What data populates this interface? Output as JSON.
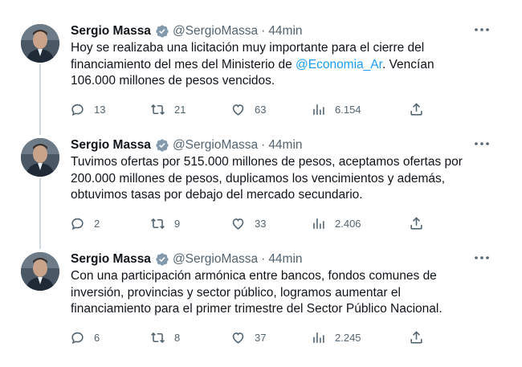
{
  "tweets": [
    {
      "author": {
        "name": "Sergio Massa",
        "handle": "@SergioMassa",
        "separator": "·",
        "time": "44min"
      },
      "text": {
        "line1": "Hoy se realizaba una licitación muy importante para el cierre del",
        "line2_before": "financiamiento del mes del Ministerio de ",
        "mention": "@Economia_Ar",
        "line2_after": ". Vencían",
        "line3": "106.000 millones de pesos vencidos."
      },
      "stats": {
        "replies": "13",
        "retweets": "21",
        "likes": "63",
        "views": "6.154"
      }
    },
    {
      "author": {
        "name": "Sergio Massa",
        "handle": "@SergioMassa",
        "separator": "·",
        "time": "44min"
      },
      "text": {
        "line1": "Tuvimos ofertas por 515.000 millones de pesos, aceptamos ofertas por",
        "line2": "200.000 millones de pesos, duplicamos los vencimientos y además,",
        "line3": "obtuvimos tasas por debajo del mercado secundario."
      },
      "stats": {
        "replies": "2",
        "retweets": "9",
        "likes": "33",
        "views": "2.406"
      }
    },
    {
      "author": {
        "name": "Sergio Massa",
        "handle": "@SergioMassa",
        "separator": "·",
        "time": "44min"
      },
      "text": {
        "line1": "Con una participación armónica entre bancos, fondos comunes de",
        "line2": "inversión, provincias y sector público, logramos aumentar el",
        "line3": "financiamiento para el primer trimestre del Sector Público Nacional."
      },
      "stats": {
        "replies": "6",
        "retweets": "8",
        "likes": "37",
        "views": "2.245"
      }
    }
  ],
  "colors": {
    "text": "#0f1419",
    "secondary": "#536471",
    "accent": "#1d9bf0",
    "thread_line": "#cfd9de"
  },
  "icons": [
    "verified-badge-icon",
    "more-icon",
    "reply-icon",
    "retweet-icon",
    "like-icon",
    "views-icon",
    "share-icon"
  ]
}
